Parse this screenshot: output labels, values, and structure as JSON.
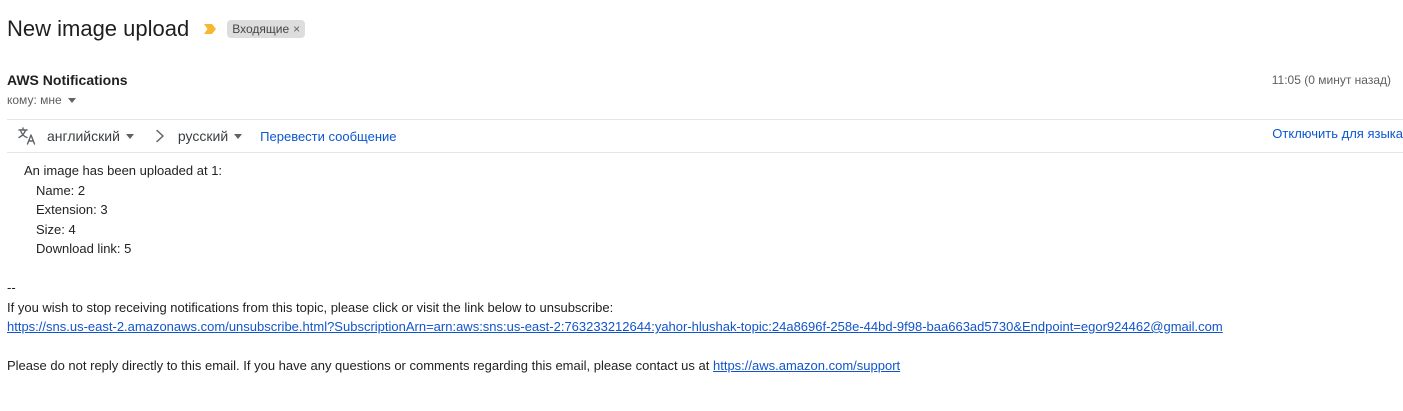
{
  "subject": {
    "title": "New image upload",
    "label": "Входящие",
    "label_remove": "×",
    "importance_color": "#f7b733"
  },
  "header": {
    "sender": "AWS Notifications",
    "to_label": "кому: мне",
    "time": "11:05 (0 минут назад)"
  },
  "translate_bar": {
    "icon": "translate-icon",
    "from_language": "английский",
    "to_language": "русский",
    "translate_link": "Перевести сообщение",
    "disable_link": "Отключить для языка"
  },
  "body": {
    "intro": "An image has been uploaded at 1:",
    "fields": [
      "Name: 2",
      "Extension: 3",
      "Size: 4",
      "Download link: 5"
    ],
    "signature_sep": "--",
    "unsubscribe_text": "If you wish to stop receiving notifications from this topic, please click or visit the link below to unsubscribe:",
    "unsubscribe_url": "https://sns.us-east-2.amazonaws.com/unsubscribe.html?SubscriptionArn=arn:aws:sns:us-east-2:763233212644:yahor-hlushak-topic:24a8696f-258e-44bd-9f98-baa663ad5730&Endpoint=egor924462@gmail.com",
    "footer_text": "Please do not reply directly to this email. If you have any questions or comments regarding this email, please contact us at",
    "support_url": "https://aws.amazon.com/support"
  },
  "colors": {
    "link": "#1155cc",
    "action_link": "#0b57d0",
    "chip_bg": "#dddddd"
  }
}
